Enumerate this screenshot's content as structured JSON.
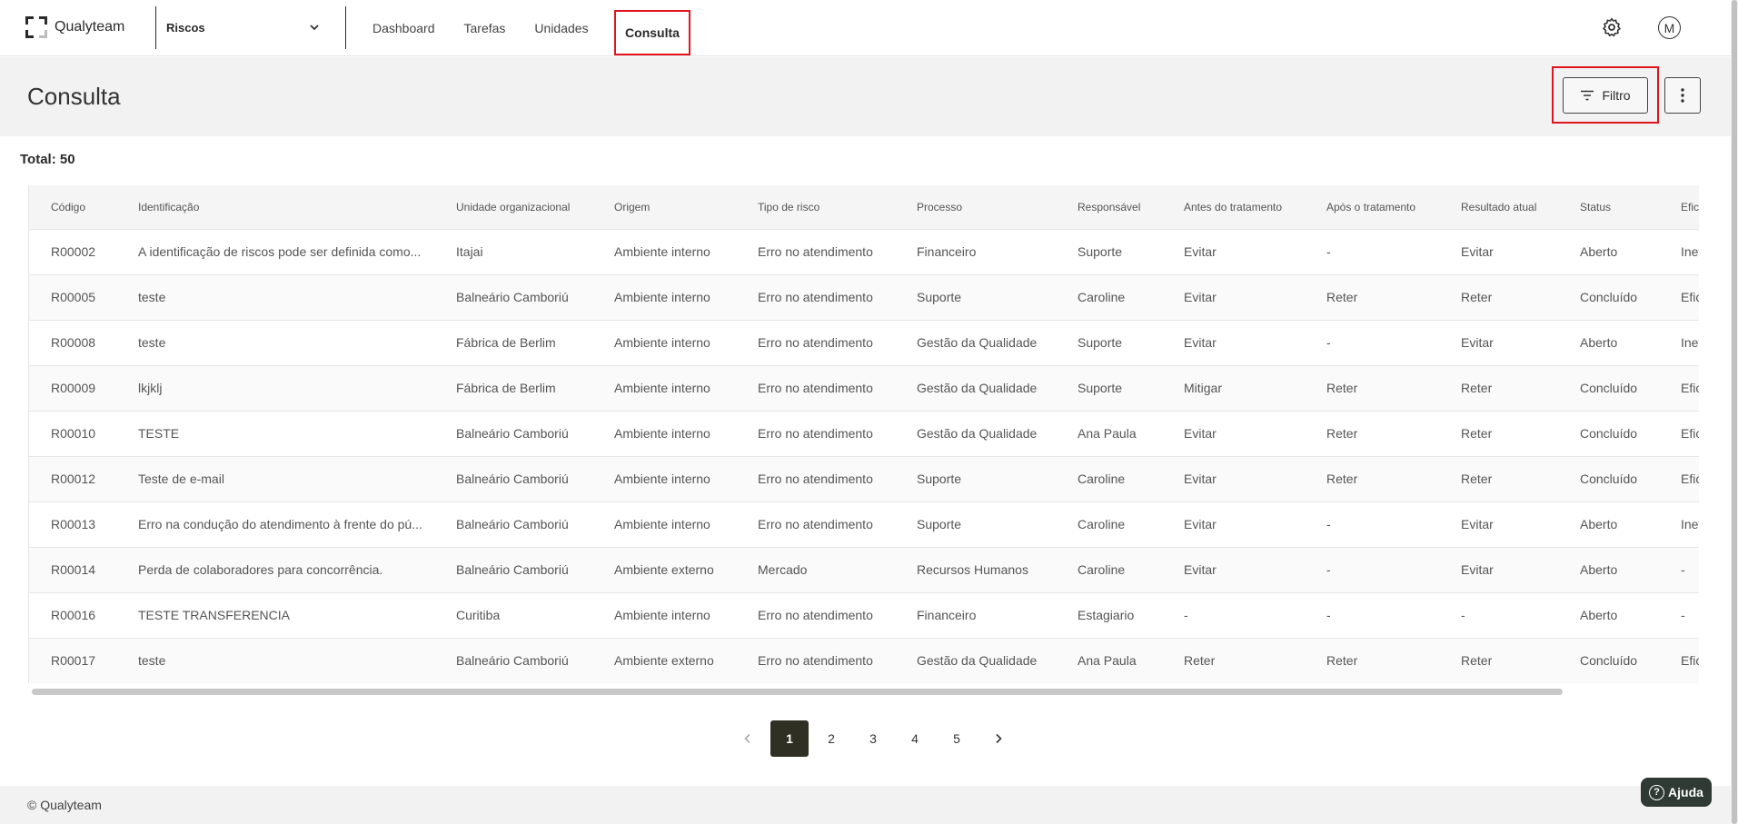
{
  "app": {
    "brand": "Qualyteam",
    "module": "Riscos"
  },
  "nav": {
    "items": [
      "Dashboard",
      "Tarefas",
      "Unidades"
    ],
    "active": "Consulta",
    "avatar_initial": "M"
  },
  "page": {
    "title": "Consulta",
    "filter_label": "Filtro",
    "total_label": "Total: 50"
  },
  "table": {
    "columns": [
      "Código",
      "Identificação",
      "Unidade organizacional",
      "Origem",
      "Tipo de risco",
      "Processo",
      "Responsável",
      "Antes do tratamento",
      "Após o tratamento",
      "Resultado atual",
      "Status",
      "Eficácia"
    ],
    "rows": [
      [
        "R00002",
        "A identificação de riscos pode ser definida como...",
        "Itajai",
        "Ambiente interno",
        "Erro no atendimento",
        "Financeiro",
        "Suporte",
        "Evitar",
        "-",
        "Evitar",
        "Aberto",
        "Ineficaz"
      ],
      [
        "R00005",
        "teste",
        "Balneário Camboriú",
        "Ambiente interno",
        "Erro no atendimento",
        "Suporte",
        "Caroline",
        "Evitar",
        "Reter",
        "Reter",
        "Concluído",
        "Eficaz"
      ],
      [
        "R00008",
        "teste",
        "Fábrica de Berlim",
        "Ambiente interno",
        "Erro no atendimento",
        "Gestão da Qualidade",
        "Suporte",
        "Evitar",
        "-",
        "Evitar",
        "Aberto",
        "Ineficaz"
      ],
      [
        "R00009",
        "lkjklj",
        "Fábrica de Berlim",
        "Ambiente interno",
        "Erro no atendimento",
        "Gestão da Qualidade",
        "Suporte",
        "Mitigar",
        "Reter",
        "Reter",
        "Concluído",
        "Eficaz"
      ],
      [
        "R00010",
        "TESTE",
        "Balneário Camboriú",
        "Ambiente interno",
        "Erro no atendimento",
        "Gestão da Qualidade",
        "Ana Paula",
        "Evitar",
        "Reter",
        "Reter",
        "Concluído",
        "Eficaz"
      ],
      [
        "R00012",
        "Teste de e-mail",
        "Balneário Camboriú",
        "Ambiente interno",
        "Erro no atendimento",
        "Suporte",
        "Caroline",
        "Evitar",
        "Reter",
        "Reter",
        "Concluído",
        "Eficaz"
      ],
      [
        "R00013",
        "Erro na condução do atendimento à frente do pú...",
        "Balneário Camboriú",
        "Ambiente interno",
        "Erro no atendimento",
        "Suporte",
        "Caroline",
        "Evitar",
        "-",
        "Evitar",
        "Aberto",
        "Ineficaz"
      ],
      [
        "R00014",
        "Perda de colaboradores para concorrência.",
        "Balneário Camboriú",
        "Ambiente externo",
        "Mercado",
        "Recursos Humanos",
        "Caroline",
        "Evitar",
        "-",
        "Evitar",
        "Aberto",
        "-"
      ],
      [
        "R00016",
        "TESTE TRANSFERENCIA",
        "Curitiba",
        "Ambiente interno",
        "Erro no atendimento",
        "Financeiro",
        "Estagiario",
        "-",
        "-",
        "-",
        "Aberto",
        "-"
      ],
      [
        "R00017",
        "teste",
        "Balneário Camboriú",
        "Ambiente externo",
        "Erro no atendimento",
        "Gestão da Qualidade",
        "Ana Paula",
        "Reter",
        "Reter",
        "Reter",
        "Concluído",
        "Eficaz"
      ]
    ]
  },
  "pagination": {
    "pages": [
      "1",
      "2",
      "3",
      "4",
      "5"
    ],
    "current": "1"
  },
  "footer": {
    "copyright": "© Qualyteam",
    "help_label": "Ajuda"
  },
  "icons": {
    "brand": "qualyteam-logo-icon",
    "dropdown": "chevron-down-icon",
    "settings": "gear-icon",
    "filter": "filter-lines-icon",
    "more": "more-vert-icon",
    "prev": "chevron-left-icon",
    "next": "chevron-right-icon",
    "help": "help-circle-icon"
  },
  "colors": {
    "highlight": "#e0141e",
    "active_page": "#2f2f23",
    "help_button": "#2f3a34"
  }
}
